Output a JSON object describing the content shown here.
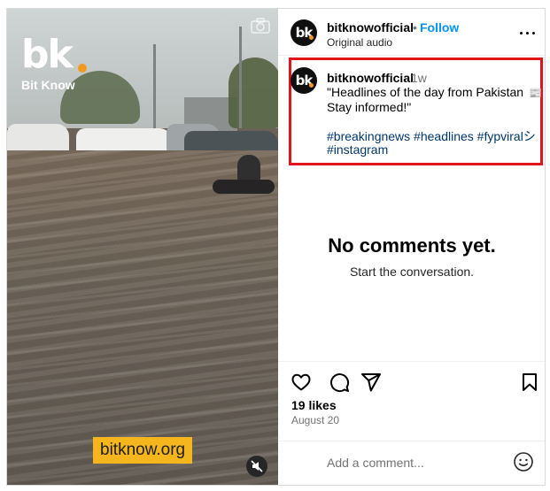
{
  "media": {
    "logo_text": "bk",
    "logo_name": "Bit Know",
    "site_badge": "bitknow.org",
    "icons": {
      "camera": "camera-icon",
      "mute": "speaker-muted-icon"
    }
  },
  "header": {
    "username": "bitknowofficial",
    "separator": "•",
    "follow_label": "Follow",
    "audio": "Original audio",
    "more_icon": "more-horizontal-icon"
  },
  "avatar": {
    "text": "bk",
    "accent": "#f29a1f"
  },
  "caption": {
    "username": "bitknowofficial",
    "time": "1w",
    "line1": "\"Headlines of the day from Pakistan",
    "line1_emoji": "📰 ✨",
    "line2": "Stay informed!\"",
    "tags_line1": "#breakingnews #headlines #fypviral",
    "tags_line1_suffix": "シ",
    "tags_line2": "#instagram",
    "highlight_color": "#e2131c"
  },
  "comments": {
    "empty_title": "No comments yet.",
    "empty_subtitle": "Start the conversation."
  },
  "actions": {
    "icons": [
      "heart-icon",
      "comment-icon",
      "share-icon",
      "bookmark-icon"
    ],
    "likes": "19 likes",
    "date": "August 20"
  },
  "composer": {
    "placeholder": "Add a comment...",
    "emoji_icon": "smiley-icon"
  },
  "colors": {
    "link": "#0095f6",
    "hashtag": "#00376b",
    "muted": "#737373"
  }
}
